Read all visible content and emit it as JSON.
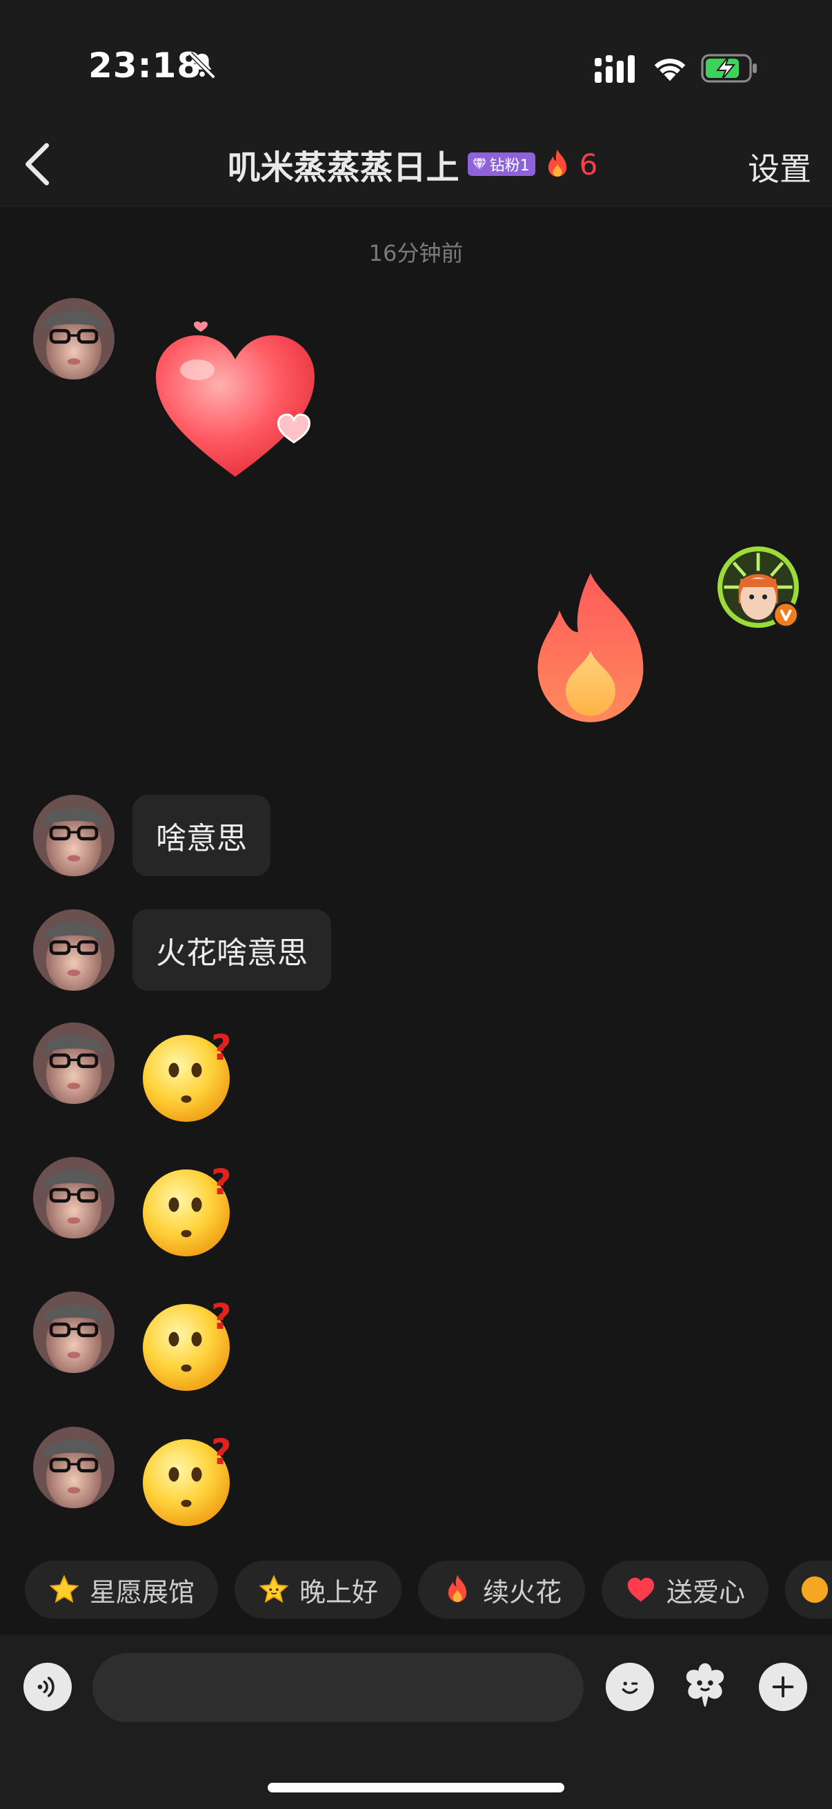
{
  "status_bar": {
    "time": "23:18",
    "icons": [
      "bell-muted-icon",
      "signal-icon",
      "wifi-icon",
      "battery-charging-icon"
    ]
  },
  "header": {
    "title": "叽米蒸蒸蒸日上",
    "fan_badge": "钻粉1",
    "spark_count": "6",
    "settings_label": "设置"
  },
  "chat": {
    "timestamp": "16分钟前",
    "messages": [
      {
        "sender": "other",
        "type": "sticker",
        "sticker": "heart-sticker"
      },
      {
        "sender": "me",
        "type": "sticker",
        "sticker": "fire-sticker"
      },
      {
        "sender": "other",
        "type": "text",
        "text": "啥意思"
      },
      {
        "sender": "other",
        "type": "text",
        "text": "火花啥意思"
      },
      {
        "sender": "other",
        "type": "emoji",
        "emoji": "confused-face-emoji"
      },
      {
        "sender": "other",
        "type": "emoji",
        "emoji": "confused-face-emoji"
      },
      {
        "sender": "other",
        "type": "emoji",
        "emoji": "confused-face-emoji"
      },
      {
        "sender": "other",
        "type": "emoji",
        "emoji": "confused-face-emoji"
      }
    ]
  },
  "quick_replies": [
    {
      "label": "星愿展馆",
      "icon": "star-icon"
    },
    {
      "label": "晚上好",
      "icon": "star-face-icon"
    },
    {
      "label": "续火花",
      "icon": "fire-icon"
    },
    {
      "label": "送爱心",
      "icon": "heart-icon"
    }
  ],
  "input": {
    "placeholder": ""
  },
  "colors": {
    "background": "#161616",
    "bubble": "#262626",
    "accent_red": "#ff3e4a",
    "badge_purple": "#8e63d9"
  }
}
